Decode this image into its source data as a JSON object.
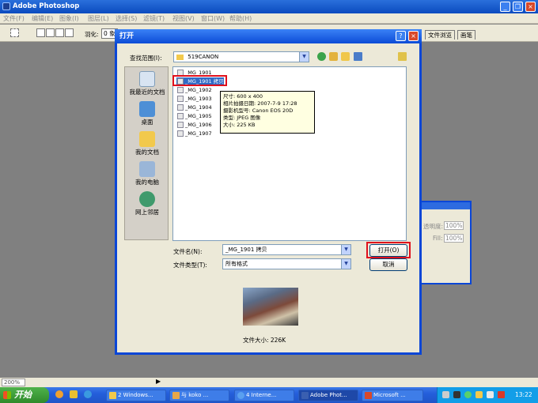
{
  "app": {
    "title": "Adobe Photoshop"
  },
  "menu": [
    "文件(F)",
    "编辑(E)",
    "图象(I)",
    "图层(L)",
    "选择(S)",
    "滤镜(T)",
    "视图(V)",
    "窗口(W)",
    "帮助(H)"
  ],
  "options": {
    "feather_label": "羽化:",
    "feather_value": "0 象",
    "tab_browse": "文件浏览",
    "tab_brush": "画笔"
  },
  "dialog": {
    "title": "打开",
    "look_in_label": "查找范围(I):",
    "look_in_value": "519CANON",
    "places": [
      "我最近的文档",
      "桌面",
      "我的文档",
      "我的电脑",
      "网上邻居"
    ],
    "files": [
      "_MG_1901",
      "_MG_1901 拷贝",
      "_MG_1902",
      "_MG_1903",
      "_MG_1904",
      "_MG_1905",
      "_MG_1906",
      "_MG_1907"
    ],
    "selected_index": 1,
    "tooltip": [
      "尺寸: 600 x 400",
      "相片拍摄日期: 2007-7-9 17:28",
      "摄影机型号: Canon EOS 20D",
      "类型: JPEG 图像",
      "大小: 225 KB"
    ],
    "filename_label": "文件名(N):",
    "filename_value": "_MG_1901 拷贝",
    "filetype_label": "文件类型(T):",
    "filetype_value": "所有格式",
    "open_button": "打开(O)",
    "cancel_button": "取消",
    "file_size": "文件大小: 226K"
  },
  "palette": {
    "opacity_label": "透明度:",
    "opacity_value": "100%",
    "fill_label": "Fill:",
    "fill_value": "100%"
  },
  "status": {
    "zoom": "200%"
  },
  "taskbar": {
    "start": "开始",
    "tasks": [
      "2 Windows...",
      "与 koko ...",
      "4 Interne...",
      "Adobe Phot...",
      "Microsoft ..."
    ],
    "clock": "13:22"
  },
  "colors": {
    "title_blue": "#0b4bbf",
    "highlight_red": "#e0101c",
    "selection_blue": "#316ac5"
  }
}
